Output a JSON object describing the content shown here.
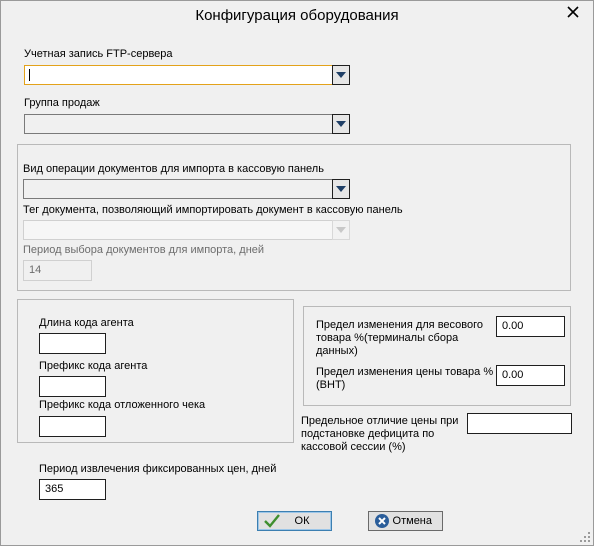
{
  "window": {
    "title": "Конфигурация оборудования"
  },
  "ftp": {
    "label": "Учетная запись FTP-сервера",
    "value": ""
  },
  "sales_group": {
    "label": "Группа продаж",
    "value": ""
  },
  "import_group": {
    "doc_operation_label": "Вид операции документов для импорта в кассовую панель",
    "doc_operation_value": "",
    "doc_tag_label": "Тег документа, позволяющий импортировать документ в кассовую панель",
    "doc_tag_value": "",
    "period_label": "Период выбора документов для импорта, дней",
    "period_value": "14"
  },
  "agent_group": {
    "agent_code_len_label": "Длина кода агента",
    "agent_code_len_value": "",
    "agent_prefix_label": "Префикс кода агента",
    "agent_prefix_value": "",
    "deferred_prefix_label": "Префикс кода отложенного чека",
    "deferred_prefix_value": ""
  },
  "limits_group": {
    "weight_limit_label": "Предел изменения для весового товара %(терминалы сбора данных)",
    "weight_limit_value": "0.00",
    "price_limit_label": "Предел изменения цены товара %(ВНТ)",
    "price_limit_value": "0.00"
  },
  "deficit": {
    "label": "Предельное отличие цены при подстановке дефицита по кассовой сессии (%)",
    "value": ""
  },
  "fixed_prices": {
    "label": "Период извлечения фиксированных цен, дней",
    "value": "365"
  },
  "buttons": {
    "ok_label": "ОК",
    "cancel_label": "Отмена"
  },
  "icons": {
    "close": "close-icon",
    "ok": "checkmark-icon",
    "cancel": "cancel-icon",
    "dropdown": "chevron-down-icon"
  },
  "colors": {
    "focus_border": "#e3a21a",
    "ok_border": "#3c7fb1",
    "check_green": "#3f8f2f",
    "cancel_blue": "#2a5d9a"
  }
}
